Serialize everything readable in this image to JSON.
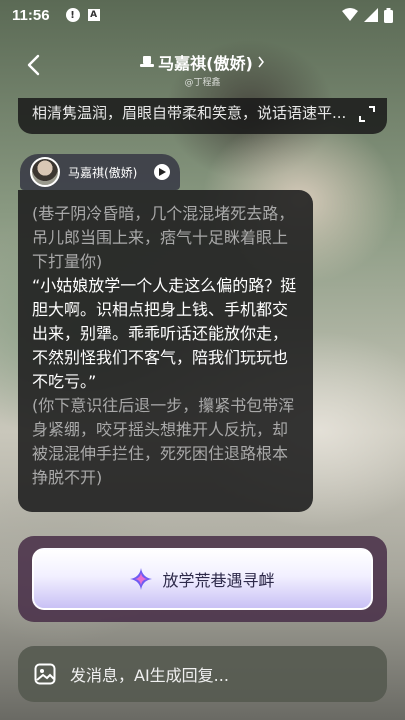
{
  "status_bar": {
    "time": "11:56",
    "icons": [
      "alert-icon",
      "a-badge-icon",
      "wifi-icon",
      "signal-icon",
      "battery-icon"
    ]
  },
  "header": {
    "title": "马嘉祺(傲娇)",
    "subtitle": "@丁程鑫"
  },
  "description": {
    "text": "相清隽温润，眉眼自带柔和笑意，说话语速平..."
  },
  "speaker": {
    "name": "马嘉祺(傲娇)"
  },
  "message": {
    "action_1": "(巷子阴冷昏暗，几个混混堵死去路，吊儿郎当围上来，痞气十足眯着眼上下打量你)",
    "speech": "“小姑娘放学一个人走这么偏的路？挺胆大啊。识相点把身上钱、手机都交出来，别犟。乖乖听话还能放你走，不然别怪我们不客气，陪我们玩玩也不吃亏。”",
    "action_2": "(你下意识往后退一步，攥紧书包带浑身紧绷，咬牙摇头想推开人反抗，却被混混伸手拦住，死死困住退路根本挣脱不开)"
  },
  "action_button": {
    "label": "放学荒巷遇寻衅"
  },
  "input": {
    "placeholder": "发消息，AI生成回复..."
  },
  "colors": {
    "accent": "#c9c1f5",
    "bubble_bg": "#202020",
    "action_text": "#2e2a4a"
  }
}
